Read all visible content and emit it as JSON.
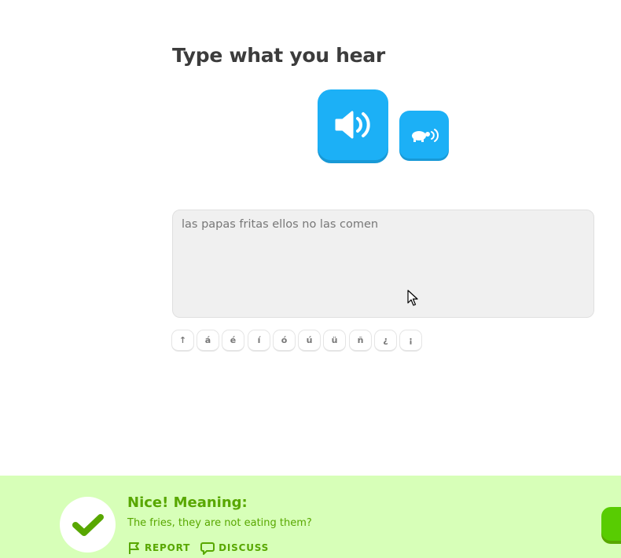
{
  "challenge": {
    "title": "Type what you hear",
    "audio_button_icon": "speaker-icon",
    "slow_audio_button_icon": "turtle-speaker-icon"
  },
  "answer": {
    "value": "las papas fritas ellos no las comen"
  },
  "special_keys": [
    "↑",
    "á",
    "é",
    "í",
    "ó",
    "ú",
    "ü",
    "ñ",
    "¿",
    "¡"
  ],
  "feedback": {
    "title": "Nice! Meaning:",
    "text": "The fries, they are not eating them?",
    "report_label": "REPORT",
    "discuss_label": "DISCUSS"
  },
  "colors": {
    "accent_blue": "#1cb0f6",
    "success_green": "#58a700",
    "success_bg": "#d7ffb8",
    "check_green": "#58cc02"
  }
}
